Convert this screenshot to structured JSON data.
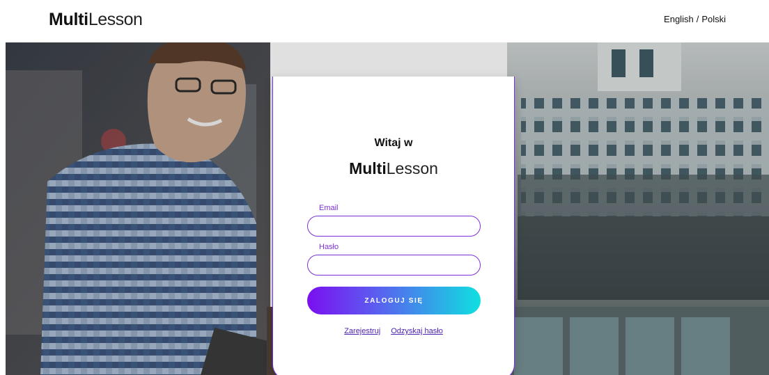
{
  "header": {
    "logo_bold": "Multi",
    "logo_light": "Lesson",
    "lang_english": "English",
    "lang_separator": "/",
    "lang_polish": "Polski"
  },
  "login": {
    "welcome": "Witaj w",
    "logo_bold": "Multi",
    "logo_light": "Lesson",
    "email_label": "Email",
    "email_value": "",
    "password_label": "Hasło",
    "password_value": "",
    "submit_label": "ZALOGUJ SIĘ",
    "register_link": "Zarejestruj",
    "recover_link": "Odzyskaj hasło"
  },
  "colors": {
    "accent": "#7b2fd6",
    "button_gradient_start": "#7a0ff0",
    "button_gradient_end": "#0fe0e0",
    "link": "#4b1fb0"
  },
  "icons": [
    "hero-background-photo"
  ]
}
